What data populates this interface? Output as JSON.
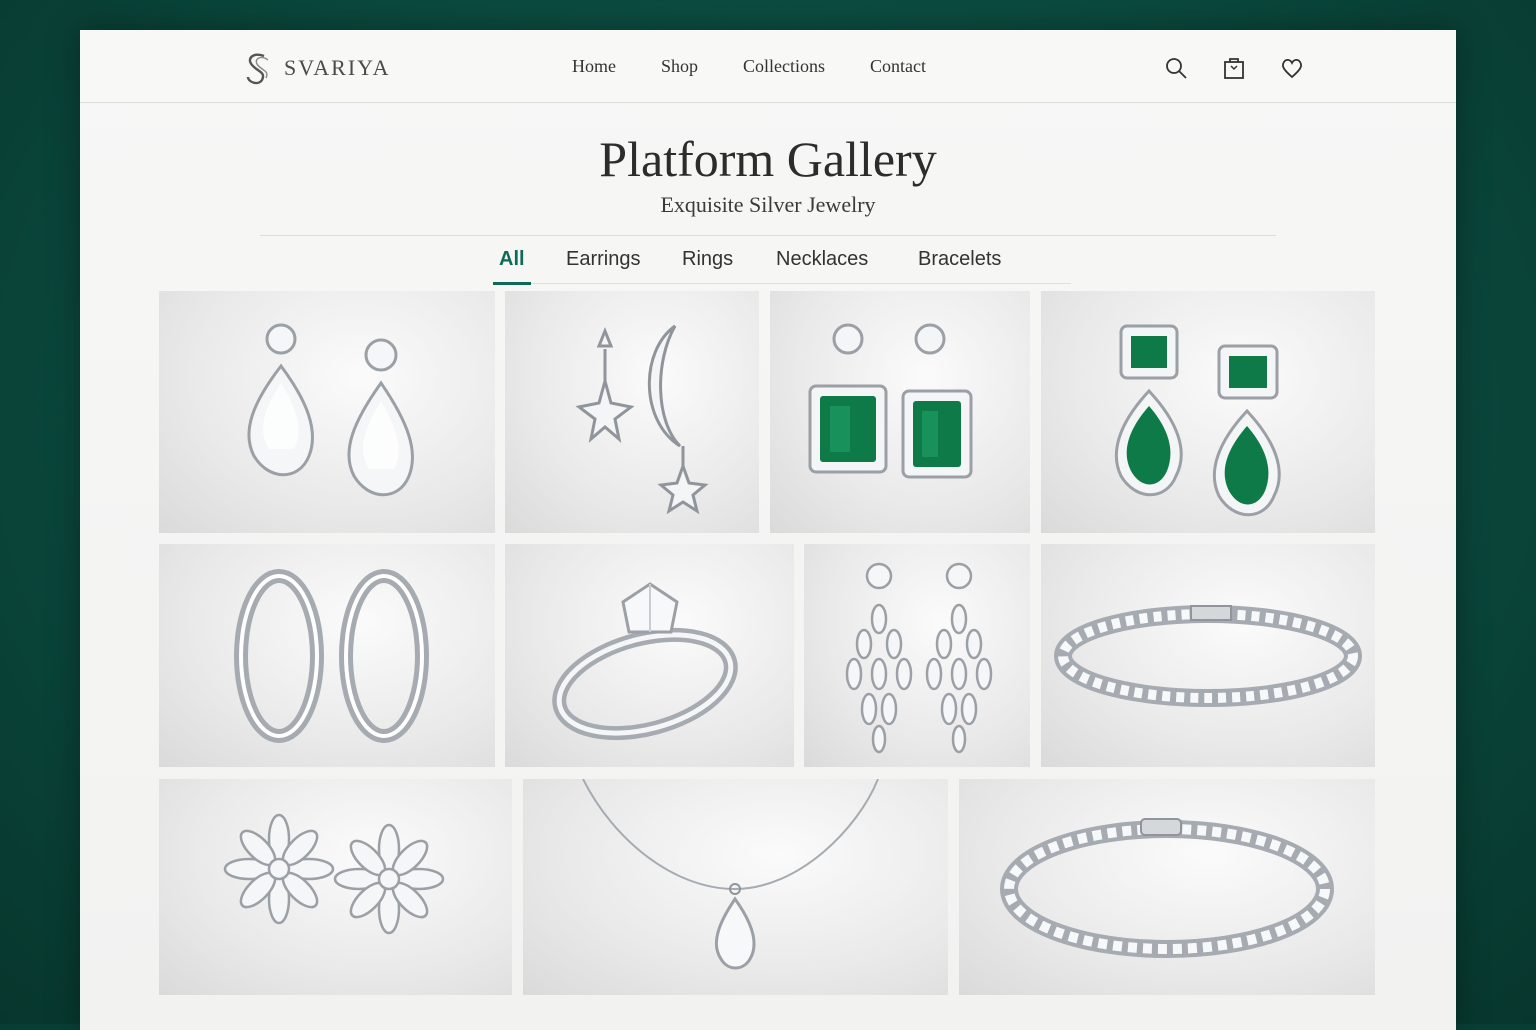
{
  "brand": {
    "name": "SVARIYA",
    "logo_icon": "s-monogram-icon"
  },
  "nav": {
    "items": [
      "Home",
      "Shop",
      "Collections",
      "Contact"
    ]
  },
  "header_icons": [
    "search-icon",
    "bag-icon",
    "heart-icon"
  ],
  "hero": {
    "title": "Platform Gallery",
    "subtitle": "Exquisite Silver Jewelry"
  },
  "filters": {
    "items": [
      "All",
      "Earrings",
      "Rings",
      "Necklaces",
      "Bracelets"
    ],
    "active": "All"
  },
  "colors": {
    "accent": "#0f6b58",
    "emerald": "#0d7a48",
    "background": "#0b4a3e"
  },
  "gallery": [
    {
      "item": "diamond teardrop halo earrings"
    },
    {
      "item": "star and crescent moon earrings"
    },
    {
      "item": "emerald-cut green halo earrings"
    },
    {
      "item": "emerald pear drop earrings"
    },
    {
      "item": "silver pave hoop earrings"
    },
    {
      "item": "solitaire diamond ring"
    },
    {
      "item": "marquise cluster chandelier earrings"
    },
    {
      "item": "diamond tennis bracelet"
    },
    {
      "item": "marquise flower stud earrings"
    },
    {
      "item": "pear pendant necklace"
    },
    {
      "item": "round diamond tennis bracelet"
    }
  ]
}
